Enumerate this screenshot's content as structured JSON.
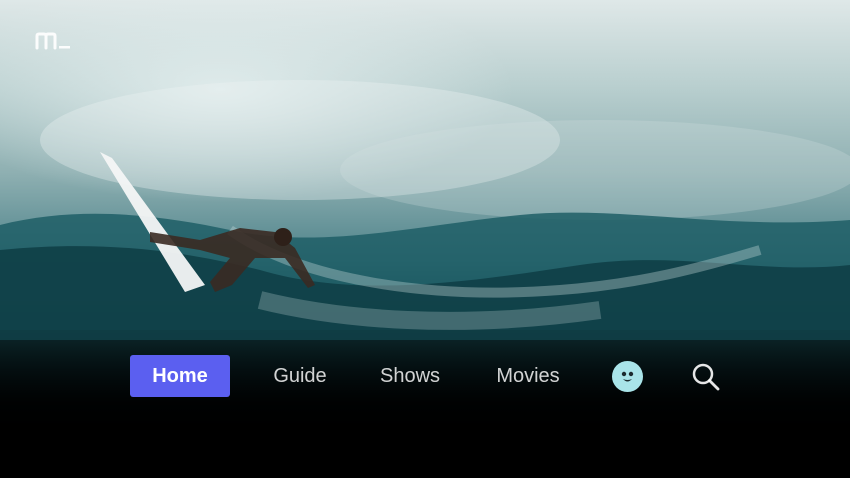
{
  "app": {
    "logo_icon": "m-underscore-logo-icon"
  },
  "nav": {
    "items": [
      {
        "label": "Home",
        "active": true
      },
      {
        "label": "Guide",
        "active": false
      },
      {
        "label": "Shows",
        "active": false
      },
      {
        "label": "Movies",
        "active": false
      }
    ],
    "profile_icon": "profile-avatar-icon",
    "search_icon": "search-icon"
  },
  "colors": {
    "accent": "#5b5ff0",
    "avatar_bg": "#a9e4e9"
  },
  "hero": {
    "image_subject": "surfer-wave-hero-image"
  }
}
